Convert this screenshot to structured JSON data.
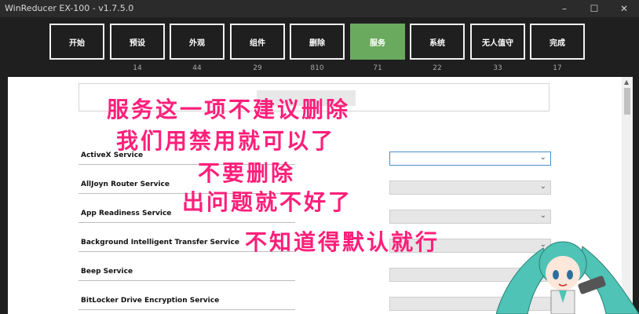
{
  "window": {
    "title": "WinReducer EX-100 - v1.7.5.0",
    "minimize_icon": "minimize-icon",
    "maximize_icon": "maximize-icon",
    "close_icon": "close-icon"
  },
  "tabs": [
    {
      "label": "开始",
      "count": ""
    },
    {
      "label": "预设",
      "count": "14"
    },
    {
      "label": "外观",
      "count": "44"
    },
    {
      "label": "组件",
      "count": "29"
    },
    {
      "label": "删除",
      "count": "810"
    },
    {
      "label": "服务",
      "count": "71",
      "active": true
    },
    {
      "label": "系统",
      "count": "22"
    },
    {
      "label": "无人值守",
      "count": "33"
    },
    {
      "label": "完成",
      "count": "17"
    }
  ],
  "services": [
    {
      "label": "ActiveX Service",
      "value": ""
    },
    {
      "label": "AllJoyn Router Service",
      "value": ""
    },
    {
      "label": "App Readiness Service",
      "value": ""
    },
    {
      "label": "Background Intelligent Transfer Service",
      "value": ""
    },
    {
      "label": "Beep Service",
      "value": ""
    },
    {
      "label": "BitLocker Drive Encryption Service",
      "value": ""
    }
  ],
  "annotation": [
    "服务这一项不建议删除",
    "我们用禁用就可以了",
    "不要删除",
    "出问题就不好了",
    "不知道得默认就行"
  ],
  "colors": {
    "active_tab": "#6aaa5e",
    "annotation": "#ff1f7a",
    "background": "#1f1f1f"
  }
}
